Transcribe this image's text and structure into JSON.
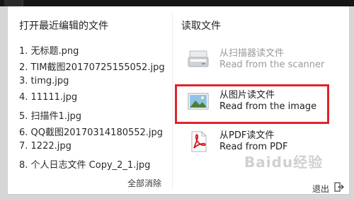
{
  "recent_section": {
    "title": "打开最近编辑的文件",
    "items": [
      "1. 无标题.png",
      "2. TIM截图20170725155052.jpg",
      "3. timg.jpg",
      "4. 11111.jpg",
      "5. 扫描件1.jpg",
      "6. QQ截图20170314180552.jpg",
      "7. 1222.jpg",
      "8. 个人日志文件 Copy_2_1.jpg"
    ],
    "clear_all": "全部消除"
  },
  "read_section": {
    "title": "读取文件",
    "sources": [
      {
        "icon": "scanner-icon",
        "label_cn": "从扫描器读文件",
        "label_en": "Read from the scanner",
        "enabled": false
      },
      {
        "icon": "image-icon",
        "label_cn": "从图片读文件",
        "label_en": "Read from the image",
        "highlighted": true
      },
      {
        "icon": "pdf-icon",
        "label_cn": "从PDF读文件",
        "label_en": "Read from PDF"
      }
    ],
    "exit_label": "退出",
    "exit_icon": "exit-icon"
  },
  "highlight_color": "#e0242b",
  "watermark": "Baidu经验"
}
